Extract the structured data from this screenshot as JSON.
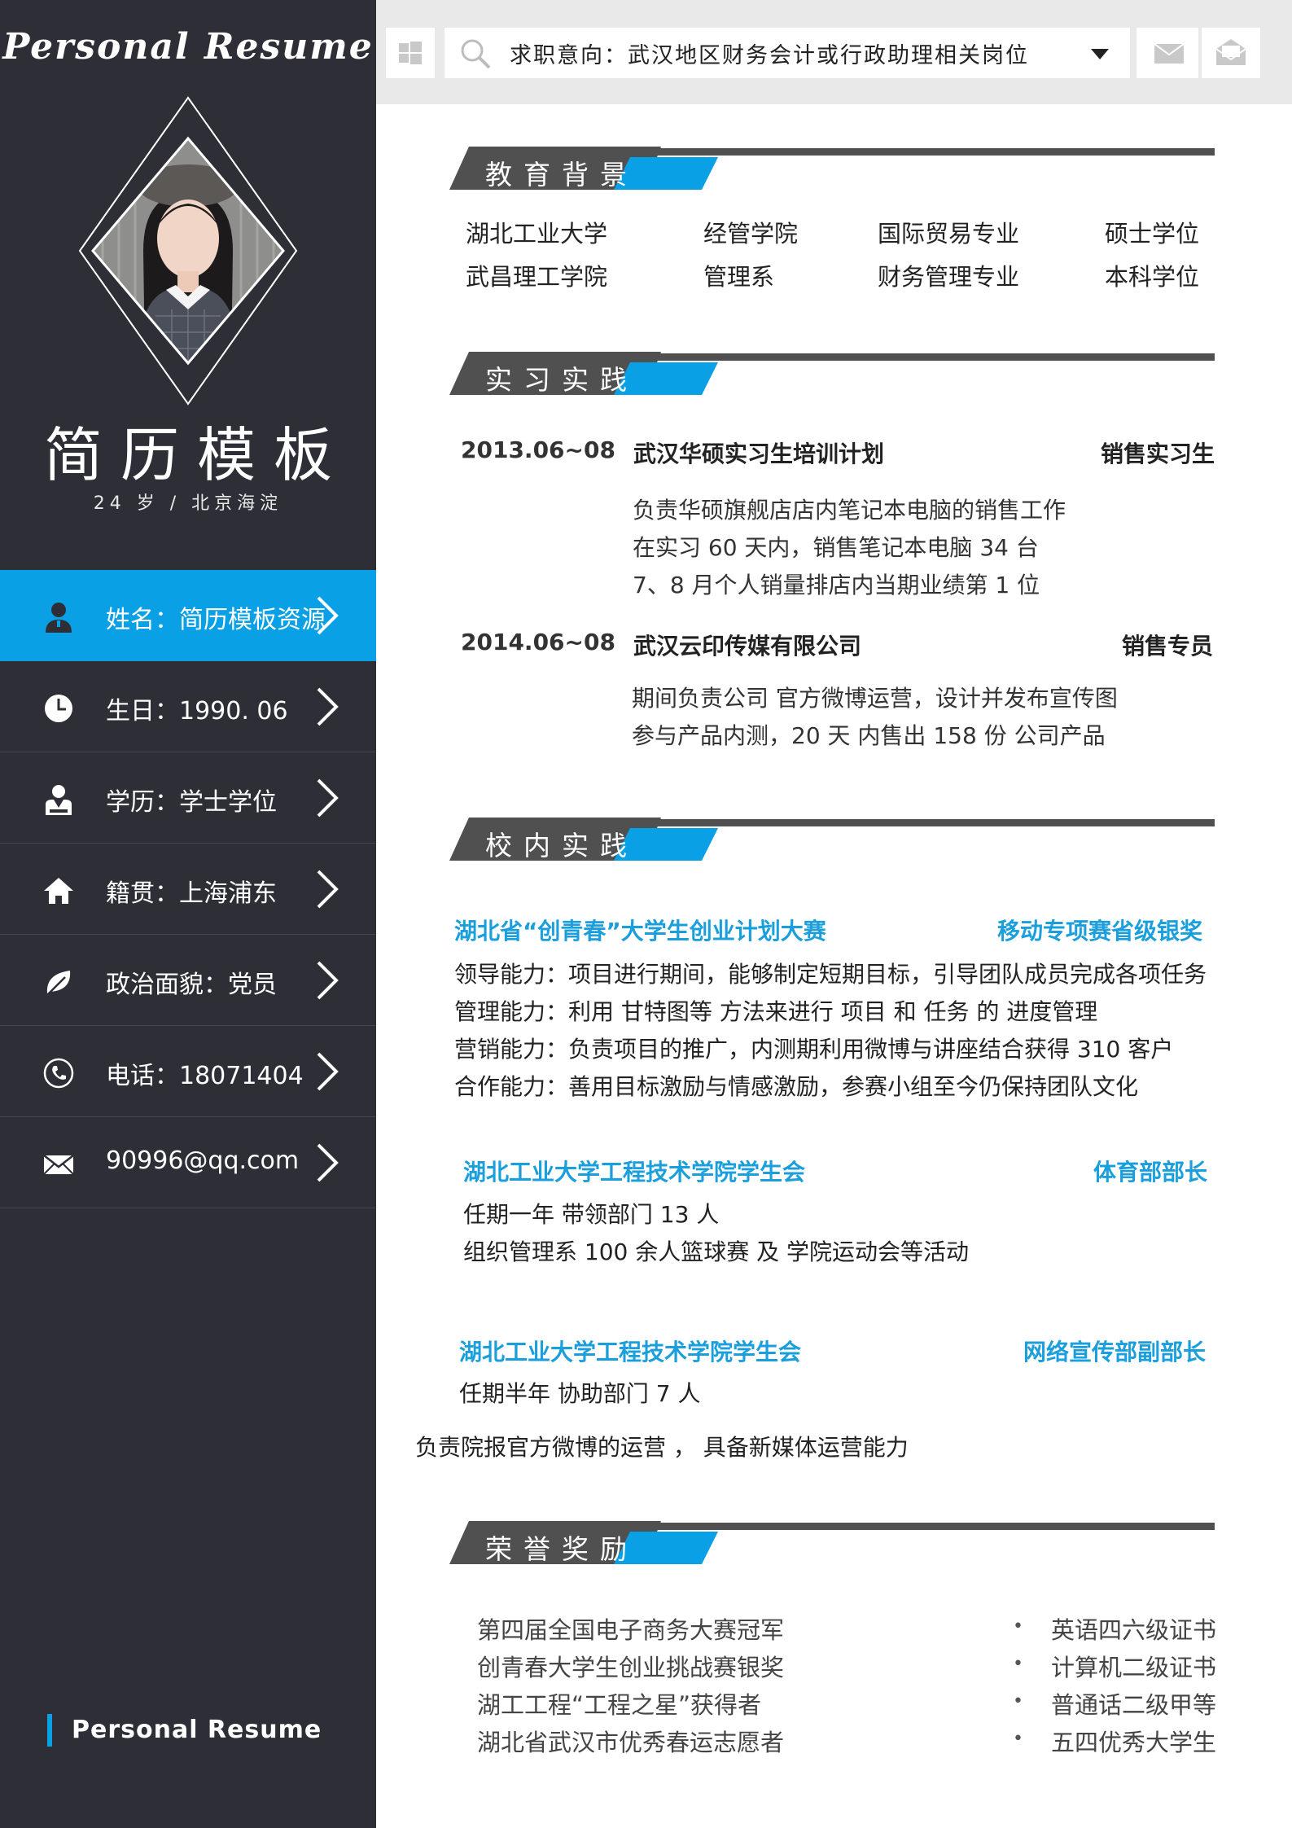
{
  "sidebar": {
    "script_title": "Personal Resume",
    "name": "简历模板",
    "subtitle": "24 岁  /  北京海淀",
    "items": [
      {
        "icon": "user-icon",
        "label": "姓名：简历模板资源",
        "active": true
      },
      {
        "icon": "clock-icon",
        "label": "生日：1990. 06"
      },
      {
        "icon": "graduate-icon",
        "label": "学历：学士学位"
      },
      {
        "icon": "home-icon",
        "label": "籍贯：上海浦东"
      },
      {
        "icon": "leaf-icon",
        "label": "政治面貌：党员"
      },
      {
        "icon": "phone-icon",
        "label": "电话：18071404"
      },
      {
        "icon": "mail-icon",
        "label": "90996@qq.com"
      }
    ],
    "footer": "Personal  Resume"
  },
  "topbar": {
    "search_text": "求职意向：武汉地区财务会计或行政助理相关岗位"
  },
  "sections": {
    "education": {
      "title": "教育背景",
      "rows": [
        [
          "湖北工业大学",
          "经管学院",
          "国际贸易专业",
          "硕士学位"
        ],
        [
          "武昌理工学院",
          "管理系",
          "财务管理专业",
          "本科学位"
        ]
      ]
    },
    "internship": {
      "title": "实习实践",
      "entries": [
        {
          "date": "2013.06~08",
          "org": "武汉华硕实习生培训计划",
          "role": "销售实习生",
          "lines": [
            "负责华硕旗舰店店内笔记本电脑的销售工作",
            "在实习 60 天内，销售笔记本电脑 34 台",
            "7、8 月个人销量排店内当期业绩第 1 位"
          ]
        },
        {
          "date": "2014.06~08",
          "org": "武汉云印传媒有限公司",
          "role": "销售专员",
          "lines": [
            "期间负责公司  官方微博运营，设计并发布宣传图",
            "参与产品内测，20 天  内售出  158 份  公司产品"
          ]
        }
      ]
    },
    "campus": {
      "title": "校内实践",
      "entries": [
        {
          "org": "湖北省“创青春”大学生创业计划大赛",
          "role": "移动专项赛省级银奖",
          "lines": [
            "领导能力：项目进行期间，能够制定短期目标，引导团队成员完成各项任务",
            "管理能力：利用    甘特图等    方法来进行  项目  和  任务  的  进度管理",
            "营销能力：负责项目的推广，内测期利用微博与讲座结合获得 310 客户",
            "合作能力：善用目标激励与情感激励，参赛小组至今仍保持团队文化"
          ]
        },
        {
          "org": "湖北工业大学工程技术学院学生会",
          "role": "体育部部长",
          "lines": [
            "任期一年        带领部门 13 人",
            "组织管理系 100 余人篮球赛    及      学院运动会等活动"
          ]
        },
        {
          "org": "湖北工业大学工程技术学院学生会",
          "role": "网络宣传部副部长",
          "lines": [
            "任期半年        协助部门 7 人",
            "负责院报官方微博的运营     ，     具备新媒体运营能力"
          ]
        }
      ]
    },
    "honors": {
      "title": "荣誉奖励",
      "left": [
        "第四届全国电子商务大赛冠军",
        "创青春大学生创业挑战赛银奖",
        "湖工工程“工程之星”获得者",
        "湖北省武汉市优秀春运志愿者"
      ],
      "bullet": "•",
      "right": [
        "英语四六级证书",
        "计算机二级证书",
        "普通话二级甲等",
        "五四优秀大学生"
      ]
    }
  },
  "colors": {
    "sidebar_bg": "#2d2e36",
    "accent": "#0aa0e6",
    "section_bar": "#505050",
    "highlight_text": "#1b9fdc"
  }
}
